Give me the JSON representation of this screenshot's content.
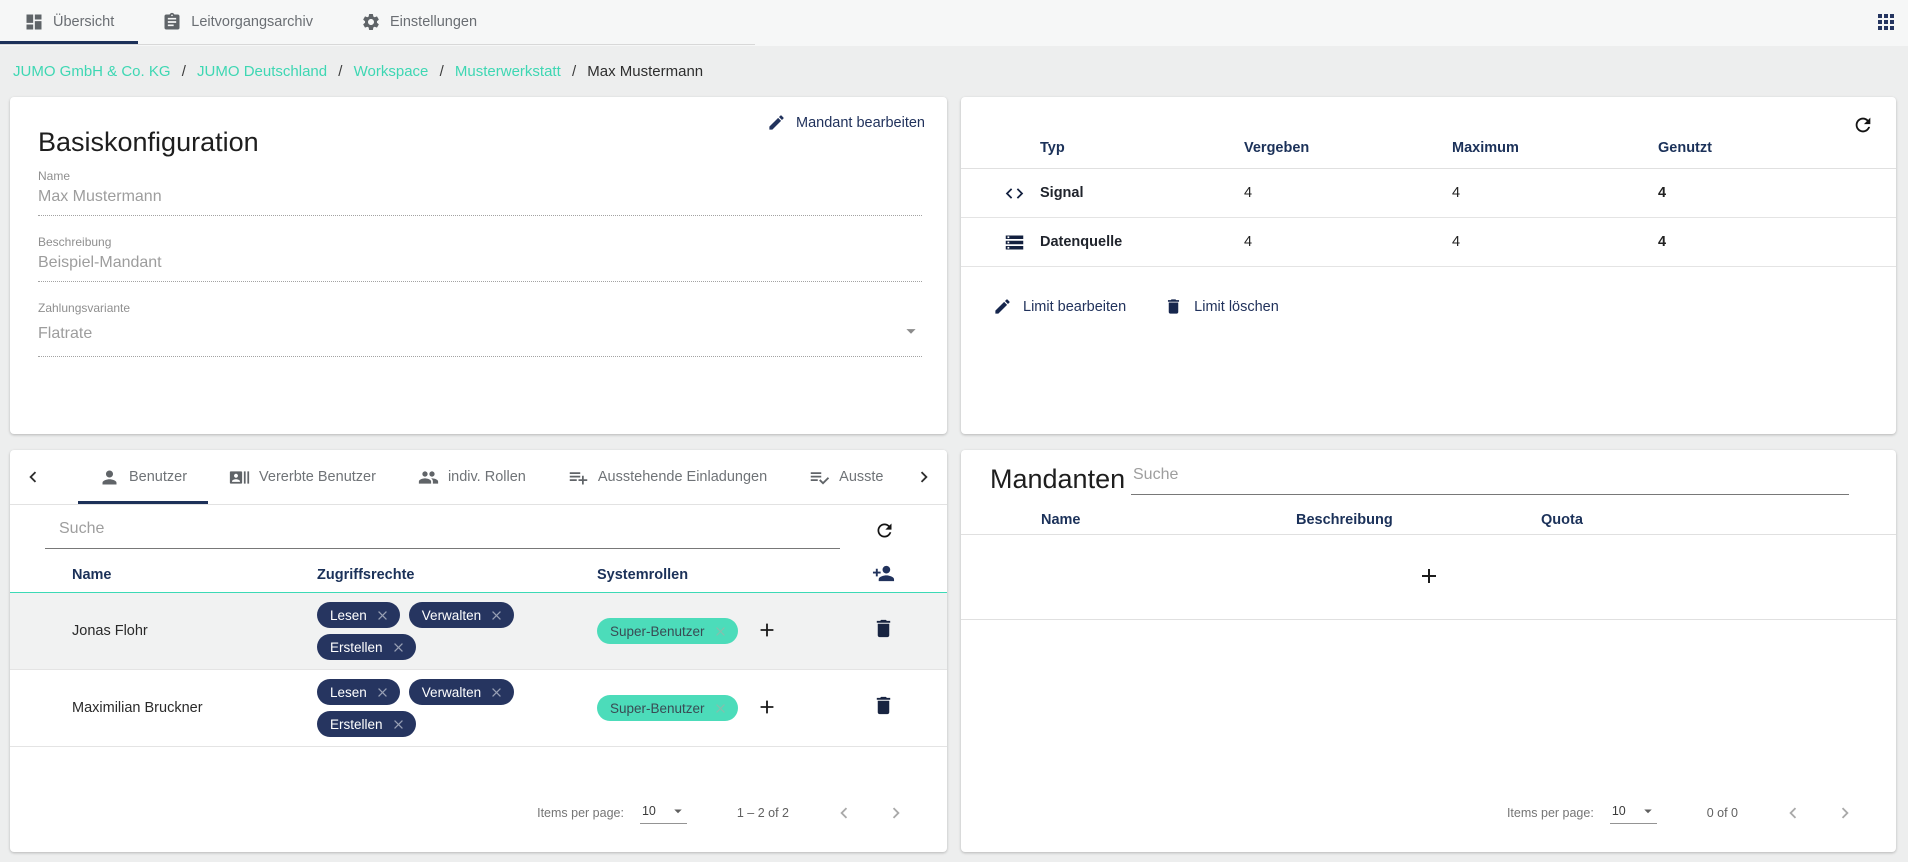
{
  "colors": {
    "navy_accent": "#253560",
    "teal_accent": "#3cdab6",
    "chip_navy_bg": "#263560",
    "chip_teal_bg": "#4cdcba",
    "header_text": "#1b3159",
    "page_background": "#edeeee"
  },
  "top_bar": {
    "tabs": [
      {
        "label": "Übersicht",
        "icon": "dashboard-icon",
        "active": true
      },
      {
        "label": "Leitvorgangsarchiv",
        "icon": "clipboard-icon",
        "active": false
      },
      {
        "label": "Einstellungen",
        "icon": "gear-icon",
        "active": false
      }
    ],
    "apps_icon": "apps-grid-icon"
  },
  "breadcrumb": {
    "separator": "/",
    "links": [
      "JUMO GmbH & Co. KG",
      "JUMO Deutschland",
      "Workspace",
      "Musterwerkstatt"
    ],
    "current": "Max Mustermann"
  },
  "basis_card": {
    "edit_button": "Mandant bearbeiten",
    "title": "Basiskonfiguration",
    "fields": [
      {
        "label": "Name",
        "value": "Max Mustermann"
      },
      {
        "label": "Beschreibung",
        "value": "Beispiel-Mandant"
      },
      {
        "label": "Zahlungsvariante",
        "value": "Flatrate"
      }
    ]
  },
  "limits_card": {
    "columns": [
      "Typ",
      "Vergeben",
      "Maximum",
      "Genutzt"
    ],
    "rows": [
      {
        "icon": "code-icon",
        "typ": "Signal",
        "vergeben": "4",
        "maximum": "4",
        "genutzt": "4"
      },
      {
        "icon": "storage-icon",
        "typ": "Datenquelle",
        "vergeben": "4",
        "maximum": "4",
        "genutzt": "4"
      }
    ],
    "edit_button": "Limit bearbeiten",
    "delete_button": "Limit löschen"
  },
  "users_card": {
    "tabs": [
      {
        "label": "Benutzer",
        "icon": "person-icon",
        "active": true
      },
      {
        "label": "Vererbte Benutzer",
        "icon": "recent-actors-icon",
        "active": false
      },
      {
        "label": "indiv. Rollen",
        "icon": "group-icon",
        "active": false
      },
      {
        "label": "Ausstehende Einladungen",
        "icon": "playlist-add-icon",
        "active": false
      },
      {
        "label": "Ausste",
        "icon": "playlist-check-icon",
        "active": false
      }
    ],
    "search_placeholder": "Suche",
    "columns": [
      "Name",
      "Zugriffsrechte",
      "Systemrollen"
    ],
    "rows": [
      {
        "name": "Jonas Flohr",
        "rights": [
          "Lesen",
          "Verwalten",
          "Erstellen"
        ],
        "role": "Super-Benutzer"
      },
      {
        "name": "Maximilian Bruckner",
        "rights": [
          "Lesen",
          "Verwalten",
          "Erstellen"
        ],
        "role": "Super-Benutzer"
      }
    ],
    "paginator": {
      "label": "Items per page:",
      "page_size": "10",
      "range": "1 – 2 of 2"
    }
  },
  "mandanten_card": {
    "title": "Mandanten",
    "search_placeholder": "Suche",
    "columns": [
      "Name",
      "Beschreibung",
      "Quota"
    ],
    "paginator": {
      "label": "Items per page:",
      "page_size": "10",
      "range": "0 of 0"
    }
  }
}
